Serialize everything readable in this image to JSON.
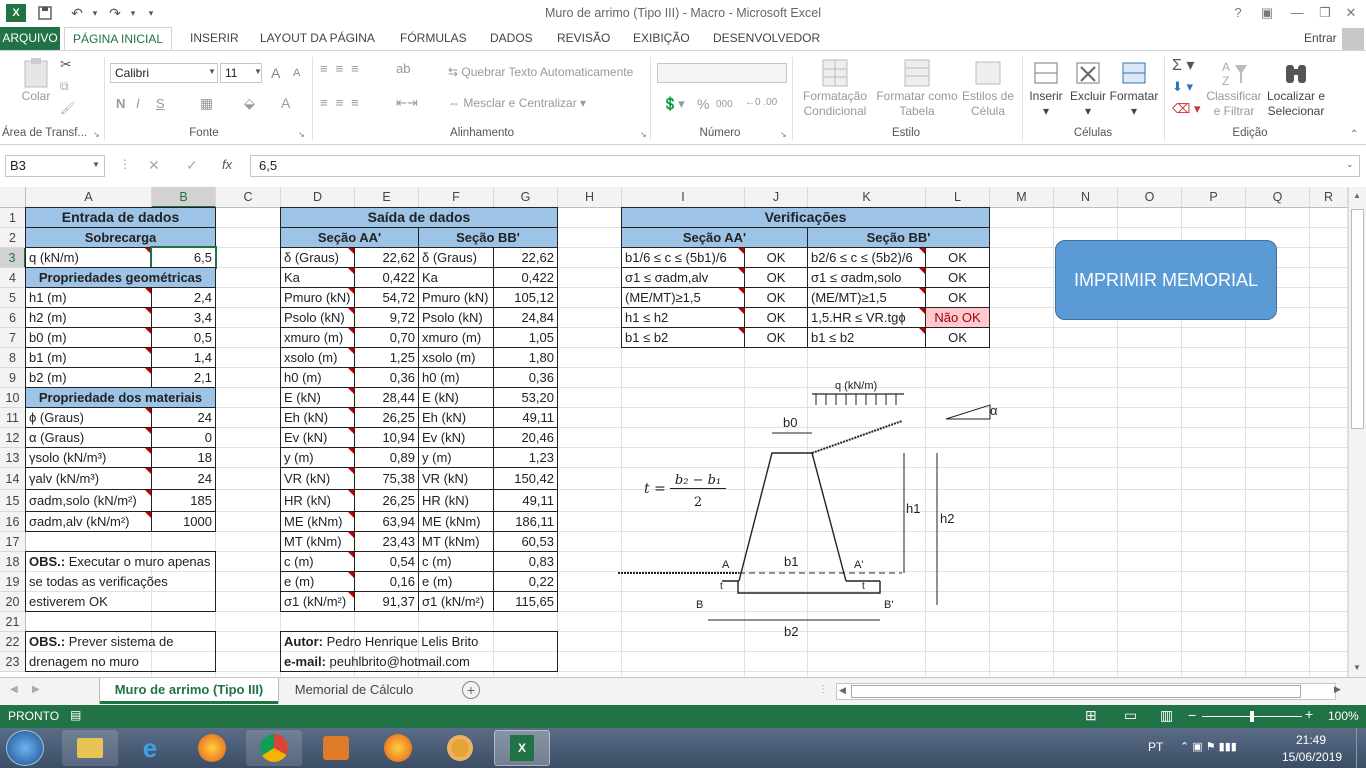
{
  "window": {
    "title": "Muro de arrimo (Tipo III) - Macro - Microsoft Excel",
    "help": "?",
    "signin": "Entrar"
  },
  "tabs": [
    "ARQUIVO",
    "PÁGINA INICIAL",
    "INSERIR",
    "LAYOUT DA PÁGINA",
    "FÓRMULAS",
    "DADOS",
    "REVISÃO",
    "EXIBIÇÃO",
    "DESENVOLVEDOR"
  ],
  "ribbon": {
    "clipboard": {
      "paste": "Colar",
      "group": "Área de Transf..."
    },
    "font": {
      "name": "Calibri",
      "size": "11",
      "bold": "N",
      "italic": "I",
      "underline": "S",
      "group": "Fonte"
    },
    "alignment": {
      "wrap": "Quebrar Texto Automaticamente",
      "merge": "Mesclar e Centralizar",
      "group": "Alinhamento"
    },
    "number": {
      "format": "",
      "group": "Número",
      "percent": "%",
      "thousands": "000"
    },
    "styles": {
      "cond1": "Formatação",
      "cond2": "Condicional",
      "table1": "Formatar como",
      "table2": "Tabela",
      "cell1": "Estilos de",
      "cell2": "Célula",
      "group": "Estilo"
    },
    "cells": {
      "insert": "Inserir",
      "delete": "Excluir",
      "format": "Formatar",
      "group": "Células"
    },
    "editing": {
      "sort1": "Classificar",
      "sort2": "e Filtrar",
      "find1": "Localizar e",
      "find2": "Selecionar",
      "group": "Edição"
    }
  },
  "formula_bar": {
    "name_box": "B3",
    "fx": "fx",
    "value": "6,5"
  },
  "columns": [
    "A",
    "B",
    "C",
    "D",
    "E",
    "F",
    "G",
    "H",
    "I",
    "J",
    "K",
    "L",
    "M",
    "N",
    "O",
    "P",
    "Q",
    "R"
  ],
  "rows": [
    "1",
    "2",
    "3",
    "4",
    "5",
    "6",
    "7",
    "8",
    "9",
    "10",
    "11",
    "12",
    "13",
    "14",
    "15",
    "16",
    "17",
    "18",
    "19",
    "20",
    "21",
    "22",
    "23"
  ],
  "entrada": {
    "title": "Entrada de dados",
    "sobrecarga": "Sobrecarga",
    "q_label": "q (kN/m)",
    "q_value": "6,5",
    "geo_title": "Propriedades geométricas",
    "geo": [
      [
        "h1 (m)",
        "2,4"
      ],
      [
        "h2 (m)",
        "3,4"
      ],
      [
        "b0 (m)",
        "0,5"
      ],
      [
        "b1 (m)",
        "1,4"
      ],
      [
        "b2 (m)",
        "2,1"
      ]
    ],
    "mat_title": "Propriedade dos materiais",
    "mat": [
      [
        "ϕ (Graus)",
        "24"
      ],
      [
        "α (Graus)",
        "0"
      ],
      [
        "γsolo (kN/m³)",
        "18"
      ],
      [
        "γalv (kN/m³)",
        "24"
      ],
      [
        "σadm,solo (kN/m²)",
        "185"
      ],
      [
        "σadm,alv (kN/m²)",
        "1000"
      ]
    ],
    "obs1_bold": "OBS.:",
    "obs1_lines": [
      " Executar o muro apenas",
      "se todas as verificações",
      "estiverem OK"
    ],
    "obs2_bold": "OBS.:",
    "obs2_lines": [
      " Prever sistema de",
      "drenagem no muro"
    ]
  },
  "saida": {
    "title": "Saída de dados",
    "secAA": "Seção AA'",
    "secBB": "Seção BB'",
    "rows": [
      [
        "δ (Graus)",
        "22,62",
        "δ (Graus)",
        "22,62"
      ],
      [
        "Ka",
        "0,422",
        "Ka",
        "0,422"
      ],
      [
        "Pmuro (kN)",
        "54,72",
        "Pmuro (kN)",
        "105,12"
      ],
      [
        "Psolo (kN)",
        "9,72",
        "Psolo (kN)",
        "24,84"
      ],
      [
        "xmuro (m)",
        "0,70",
        "xmuro (m)",
        "1,05"
      ],
      [
        "xsolo (m)",
        "1,25",
        "xsolo (m)",
        "1,80"
      ],
      [
        "h0 (m)",
        "0,36",
        "h0 (m)",
        "0,36"
      ],
      [
        "E (kN)",
        "28,44",
        "E (kN)",
        "53,20"
      ],
      [
        "Eh (kN)",
        "26,25",
        "Eh (kN)",
        "49,11"
      ],
      [
        "Ev (kN)",
        "10,94",
        "Ev (kN)",
        "20,46"
      ],
      [
        "y (m)",
        "0,89",
        "y (m)",
        "1,23"
      ],
      [
        "VR (kN)",
        "75,38",
        "VR (kN)",
        "150,42"
      ],
      [
        "HR (kN)",
        "26,25",
        "HR (kN)",
        "49,11"
      ],
      [
        "ME (kNm)",
        "63,94",
        "ME (kNm)",
        "186,11"
      ],
      [
        "MT (kNm)",
        "23,43",
        "MT (kNm)",
        "60,53"
      ],
      [
        "c (m)",
        "0,54",
        "c (m)",
        "0,83"
      ],
      [
        "e (m)",
        "0,16",
        "e (m)",
        "0,22"
      ],
      [
        "σ1 (kN/m²)",
        "91,37",
        "σ1 (kN/m²)",
        "115,65"
      ]
    ],
    "author_bold": "Autor:",
    "author": " Pedro Henrique Lelis Brito",
    "email_bold": "e-mail:",
    "email": " peuhlbrito@hotmail.com"
  },
  "verif": {
    "title": "Verificações",
    "secAA": "Seção AA'",
    "secBB": "Seção BB'",
    "rows": [
      [
        "b1/6 ≤ c ≤ (5b1)/6",
        "OK",
        "b2/6 ≤ c ≤ (5b2)/6",
        "OK"
      ],
      [
        "σ1 ≤ σadm,alv",
        "OK",
        "σ1 ≤ σadm,solo",
        "OK"
      ],
      [
        "(ME/MT)≥1,5",
        "OK",
        "(ME/MT)≥1,5",
        "OK"
      ],
      [
        "h1 ≤ h2",
        "OK",
        "1,5.HR ≤ VR.tgϕ",
        "Não OK"
      ],
      [
        "b1 ≤ b2",
        "OK",
        "b1 ≤ b2",
        "OK"
      ]
    ]
  },
  "print_button": "IMPRIMIR MEMORIAL",
  "diagram": {
    "q": "q (kN/m)",
    "b0": "b0",
    "alpha": "α",
    "h1": "h1",
    "h2": "h2",
    "b1": "b1",
    "b2": "b2",
    "A": "A",
    "A2": "A'",
    "B": "B",
    "B2": "B'",
    "t": "t",
    "formula_t": "t =",
    "formula_num": "b₂ − b₁",
    "formula_den": "2"
  },
  "sheets": [
    "Muro de arrimo (Tipo III)",
    "Memorial de Cálculo"
  ],
  "status": {
    "mode": "PRONTO",
    "zoom": "100%"
  },
  "taskbar": {
    "lang": "PT",
    "time": "21:49",
    "date": "15/06/2019"
  },
  "colors": {
    "excel_green": "#217346",
    "header_blue": "#9dc3e6",
    "button_blue": "#5b9bd5",
    "bad_fill": "#ffc7ce"
  }
}
